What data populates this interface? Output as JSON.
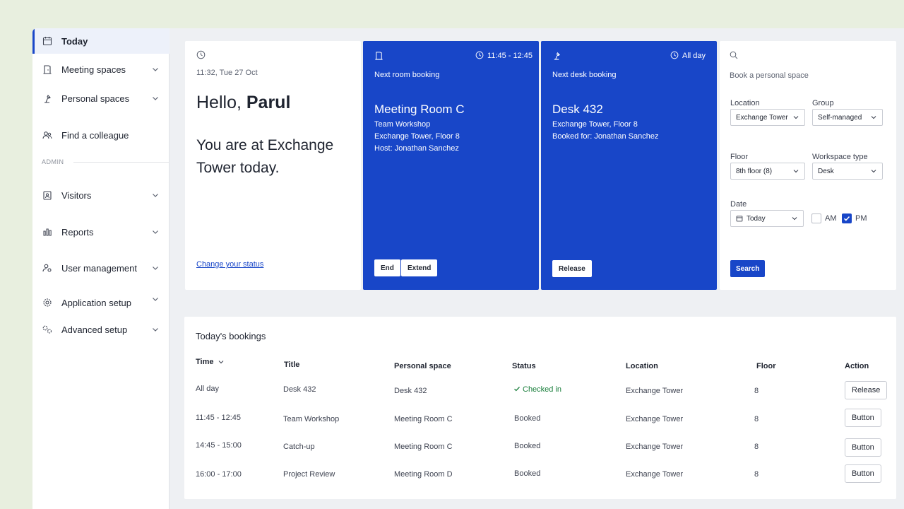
{
  "colors": {
    "accent": "#1846c8",
    "success": "#1a7f3c",
    "page_bg": "#e8efdf"
  },
  "sidebar": {
    "items": [
      {
        "label": "Today",
        "icon": "calendar-icon"
      },
      {
        "label": "Meeting spaces",
        "icon": "door-icon"
      },
      {
        "label": "Personal spaces",
        "icon": "desk-lamp-icon"
      },
      {
        "label": "Find a colleague",
        "icon": "people-icon"
      },
      {
        "label": "Visitors",
        "icon": "badge-icon"
      },
      {
        "label": "Reports",
        "icon": "bar-chart-icon"
      },
      {
        "label": "User management",
        "icon": "user-gear-icon"
      },
      {
        "label": "Application setup",
        "icon": "gear-icon"
      },
      {
        "label": "Advanced setup",
        "icon": "gears-icon"
      }
    ],
    "section_admin": "ADMIN"
  },
  "status_card": {
    "datetime": "11:32, Tue 27 Oct",
    "greeting": "Hello, ",
    "name": "Parul",
    "location_message": "You are at Exchange Tower today.",
    "change_status_link": "Change your status"
  },
  "room_card": {
    "time": "11:45 - 12:45",
    "heading": "Next room booking",
    "room": "Meeting Room C",
    "line1": "Team Workshop",
    "line2": "Exchange Tower, Floor 8",
    "line3": "Host: Jonathan Sanchez",
    "end_button": "End",
    "extend_button": "Extend"
  },
  "desk_card": {
    "time": "All day",
    "heading": "Next desk booking",
    "desk": "Desk 432",
    "line1": "Exchange Tower, Floor 8",
    "line2": "Booked for: Jonathan Sanchez",
    "release_button": "Release"
  },
  "search_card": {
    "heading": "Book a personal space",
    "location_label": "Location",
    "location_value": "Exchange Tower",
    "group_label": "Group",
    "group_value": "Self-managed",
    "floor_label": "Floor",
    "floor_value": "8th floor (8)",
    "workspace_label": "Workspace type",
    "workspace_value": "Desk",
    "date_label": "Date",
    "date_value": "Today",
    "am_label": "AM",
    "am_checked": false,
    "pm_label": "PM",
    "pm_checked": true,
    "search_button": "Search"
  },
  "bookings": {
    "title": "Today's bookings",
    "columns": [
      "Time",
      "Title",
      "Personal space",
      "Status",
      "Location",
      "Floor",
      "Action"
    ],
    "rows": [
      {
        "time": "All day",
        "title": "Desk 432",
        "space": "Desk 432",
        "status": "Checked in",
        "location": "Exchange Tower",
        "floor": "8",
        "action": "Release"
      },
      {
        "time": "11:45 - 12:45",
        "title": "Team Workshop",
        "space": "Meeting Room C",
        "status": "Booked",
        "location": "Exchange Tower",
        "floor": "8",
        "action": "Button"
      },
      {
        "time": "14:45 - 15:00",
        "title": "Catch-up",
        "space": "Meeting Room C",
        "status": "Booked",
        "location": "Exchange Tower",
        "floor": "8",
        "action": "Button"
      },
      {
        "time": "16:00 - 17:00",
        "title": "Project Review",
        "space": "Meeting Room D",
        "status": "Booked",
        "location": "Exchange Tower",
        "floor": "8",
        "action": "Button"
      }
    ]
  }
}
